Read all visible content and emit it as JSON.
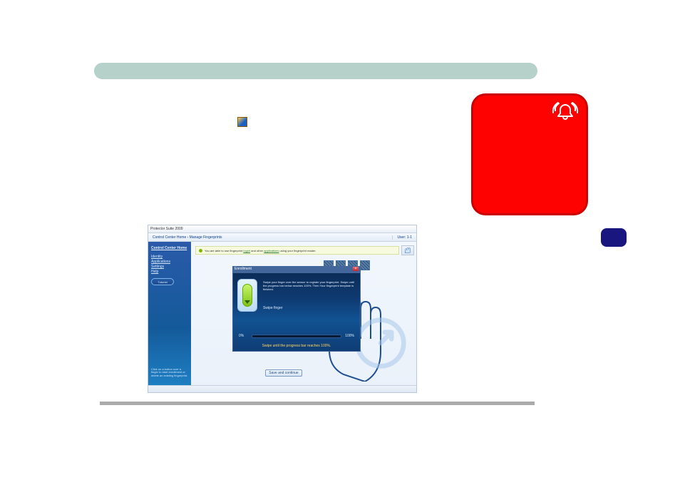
{
  "header_bar_label": "",
  "alarm_box_label": "",
  "app_window": {
    "title": "Protector Suite 2009",
    "breadcrumb": "Control Center Home  ›  Manage Fingerprints",
    "user_label": "User: 1-1",
    "info_banner": {
      "prefix": "You are able to use fingerprint ",
      "link1": "logon",
      "mid": " and other ",
      "link2": "applications",
      "suffix": " using your fingerprint reader."
    },
    "sidebar": {
      "heading": "Control Center Home",
      "items": [
        "Identity",
        "Applications",
        "Settings",
        "Help"
      ],
      "tutorial": "Tutorial",
      "hint": "Click on a button over a finger to start enrollment or delete an existing fingerprint."
    },
    "enroll": {
      "title": "Enrollment",
      "instructions": "Swipe your finger over the sensor to register your fingerprint. Swipe until the progress bar below reaches 100%. Then Your fingerprint template is finished.",
      "swipe_label": "Swipe finger",
      "pct_start": "0%",
      "pct_end": "100%",
      "swipe_until": "Swipe until the progress bar reaches 100%."
    },
    "save_button": "Save and continue"
  }
}
